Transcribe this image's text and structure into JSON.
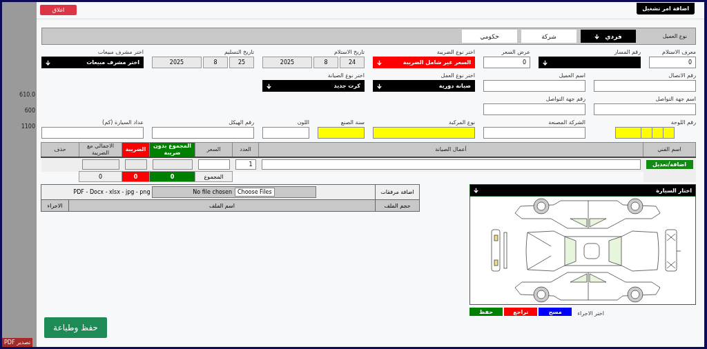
{
  "background_app": {
    "cells": [
      "610.0",
      "600",
      "1100"
    ],
    "export_button": "تصدير PDF"
  },
  "modal": {
    "title": "اضافة امر تشغيل",
    "close_button": "اغلاق"
  },
  "customer_type": {
    "label": "نوع العميل",
    "options": [
      {
        "label": "فردي",
        "selected": true
      },
      {
        "label": "شركة",
        "selected": false
      },
      {
        "label": "حكومي",
        "selected": false
      }
    ]
  },
  "field_rows": [
    [
      {
        "kind": "input",
        "label": "معرف الاستلام",
        "value": "0"
      },
      {
        "kind": "select",
        "label": "رقم المسار",
        "color": "#000000"
      },
      {
        "kind": "input",
        "label": "عرض السعر",
        "value": "0"
      },
      {
        "kind": "select",
        "label": "اختر نوع الضريبة",
        "value": "السعر غير شامل الضريبة",
        "color": "#ff0000"
      },
      {
        "kind": "date",
        "label": "تاريخ الاستلام",
        "day": "24",
        "month": "8",
        "year": "2025"
      },
      {
        "kind": "date",
        "label": "تاريخ التسليم",
        "day": "25",
        "month": "8",
        "year": "2025"
      },
      {
        "kind": "select",
        "label": "اختر مشرف مبيعات",
        "value": "اختر مشرف مبيعات",
        "color": "#000000"
      }
    ],
    [
      {
        "kind": "input",
        "label": "رقم الاتصال"
      },
      {
        "kind": "input",
        "label": "اسم العميل"
      },
      {
        "kind": "select",
        "label": "اختر نوع العمل",
        "value": "صيانة دورية",
        "color": "#000000"
      },
      {
        "kind": "select",
        "label": "اختر نوع الصيانة",
        "value": "كرت جديد",
        "color": "#000000"
      }
    ],
    [
      {
        "kind": "input",
        "label": "اسم جهة التواصل"
      },
      {
        "kind": "input",
        "label": "رقم جهة التواصل"
      }
    ],
    [
      {
        "kind": "plate",
        "label": "رقم اللوحة",
        "highlighted": true
      },
      {
        "kind": "input",
        "label": "الشركة المصنعة"
      },
      {
        "kind": "input",
        "label": "نوع المركبة",
        "highlighted": true
      },
      {
        "kind": "input",
        "label": "سنة الصنع",
        "highlighted": true
      },
      {
        "kind": "input",
        "label": "اللون"
      },
      {
        "kind": "input",
        "label": "رقم الهيكل"
      },
      {
        "kind": "input",
        "label": "عداد السيارة (كم)"
      }
    ]
  ],
  "services_table": {
    "columns": [
      {
        "label": "اسم الفني"
      },
      {
        "label": "أعمال الصيانة"
      },
      {
        "label": "العدد"
      },
      {
        "label": "السعر"
      },
      {
        "label": "المجموع بدون ضريبة",
        "color": "#008000"
      },
      {
        "label": "الضريبة",
        "color": "#ff0000"
      },
      {
        "label": "الاجمالي مع الضريبة"
      },
      {
        "label": "حذف"
      }
    ],
    "add_button": "اضافة/تعديل",
    "quantity": "1",
    "totals": {
      "label": "المجموع",
      "without_tax": "0",
      "tax": "0",
      "total": "0"
    }
  },
  "attachments": {
    "label": "اضافة مرفقات",
    "file_button": "Choose Files",
    "file_status": "No file chosen",
    "allowed_types": "PDF - Docx - xlsx - jpg - png",
    "columns": [
      "حجم الملف",
      "اسم الملف",
      "الاجراء"
    ]
  },
  "car_panel": {
    "title": "اختار السيارة",
    "action_label": "اختر الاجراء",
    "buttons": [
      {
        "label": "مسح",
        "color": "#0000ff"
      },
      {
        "label": "تراجع",
        "color": "#ff0000"
      },
      {
        "label": "حفظ",
        "color": "#008000"
      }
    ]
  },
  "save_print_button": "حفظ وطباعة"
}
